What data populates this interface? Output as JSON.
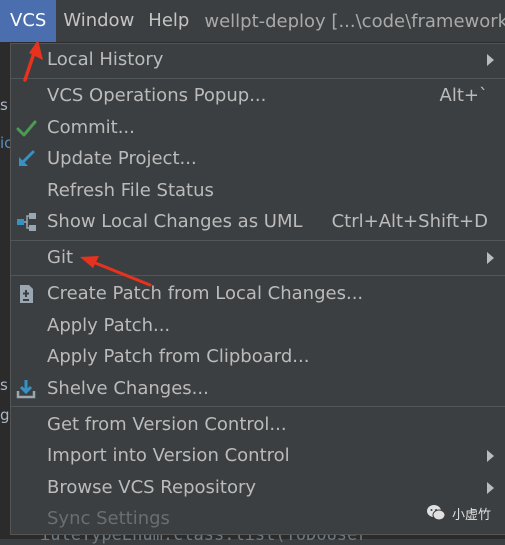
{
  "menubar": {
    "items": [
      {
        "label": "VCS",
        "active": true
      },
      {
        "label": "Window",
        "active": false
      },
      {
        "label": "Help",
        "active": false
      }
    ],
    "title": "wellpt-deploy [...\\code\\framework"
  },
  "left_edge": {
    "chars": [
      "s",
      "ic",
      "s",
      "g"
    ]
  },
  "bottom_text": "iuleTypeEnum.class.list(ToDoUser",
  "dropdown": {
    "items": [
      {
        "label": "Local History",
        "submenu": true
      },
      {
        "label": "VCS Operations Popup...",
        "shortcut": "Alt+`"
      },
      {
        "label": "Commit...",
        "icon": "check-icon"
      },
      {
        "label": "Update Project...",
        "icon": "update-arrow-icon"
      },
      {
        "label": "Refresh File Status"
      },
      {
        "label": "Show Local Changes as UML",
        "shortcut": "Ctrl+Alt+Shift+D",
        "icon": "uml-diagram-icon"
      },
      {
        "label": "Git",
        "submenu": true
      },
      {
        "label": "Create Patch from Local Changes...",
        "icon": "patch-icon"
      },
      {
        "label": "Apply Patch..."
      },
      {
        "label": "Apply Patch from Clipboard..."
      },
      {
        "label": "Shelve Changes...",
        "icon": "shelve-icon"
      },
      {
        "label": "Get from Version Control..."
      },
      {
        "label": "Import into Version Control",
        "submenu": true
      },
      {
        "label": "Browse VCS Repository",
        "submenu": true
      },
      {
        "label": "Sync Settings",
        "disabled": true
      }
    ]
  },
  "watermark": {
    "text": "小虚竹",
    "logo": "wechat-logo"
  },
  "colors": {
    "menu_bg": "#3c3f41",
    "active": "#4b6eaf",
    "text": "#bbbbbb",
    "check": "#499c54",
    "update": "#3592c4",
    "annotation": "#e8321e"
  }
}
